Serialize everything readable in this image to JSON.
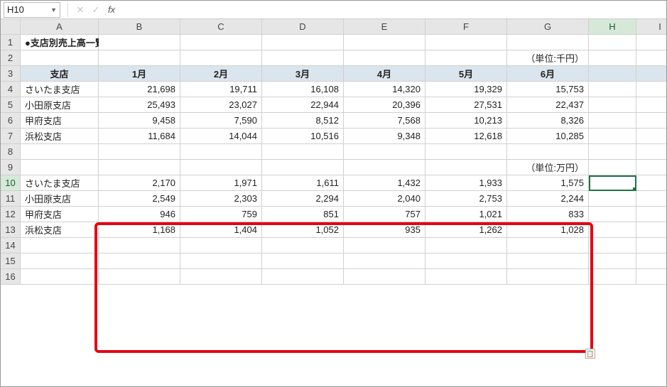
{
  "active_cell": "H10",
  "columns": [
    "A",
    "B",
    "C",
    "D",
    "E",
    "F",
    "G",
    "H",
    "I"
  ],
  "rows": [
    "1",
    "2",
    "3",
    "4",
    "5",
    "6",
    "7",
    "8",
    "9",
    "10",
    "11",
    "12",
    "13",
    "14",
    "15",
    "16"
  ],
  "title": "●支店別売上高一覧（上半期）",
  "unit_top": "（単位:千円）",
  "unit_bottom": "（単位:万円）",
  "header": {
    "store": "支店",
    "m1": "1月",
    "m2": "2月",
    "m3": "3月",
    "m4": "4月",
    "m5": "5月",
    "m6": "6月"
  },
  "data_top": [
    {
      "store": "さいたま支店",
      "v": [
        "21,698",
        "19,711",
        "16,108",
        "14,320",
        "19,329",
        "15,753"
      ]
    },
    {
      "store": "小田原支店",
      "v": [
        "25,493",
        "23,027",
        "22,944",
        "20,396",
        "27,531",
        "22,437"
      ]
    },
    {
      "store": "甲府支店",
      "v": [
        "9,458",
        "7,590",
        "8,512",
        "7,568",
        "10,213",
        "8,326"
      ]
    },
    {
      "store": "浜松支店",
      "v": [
        "11,684",
        "14,044",
        "10,516",
        "9,348",
        "12,618",
        "10,285"
      ]
    }
  ],
  "data_bottom": [
    {
      "store": "さいたま支店",
      "v": [
        "2,170",
        "1,971",
        "1,611",
        "1,432",
        "1,933",
        "1,575"
      ]
    },
    {
      "store": "小田原支店",
      "v": [
        "2,549",
        "2,303",
        "2,294",
        "2,040",
        "2,753",
        "2,244"
      ]
    },
    {
      "store": "甲府支店",
      "v": [
        "946",
        "759",
        "851",
        "757",
        "1,021",
        "833"
      ]
    },
    {
      "store": "浜松支店",
      "v": [
        "1,168",
        "1,404",
        "1,052",
        "935",
        "1,262",
        "1,028"
      ]
    }
  ],
  "chart_data": {
    "type": "table",
    "title": "支店別売上高一覧（上半期）",
    "series": [
      {
        "name": "千円",
        "categories": [
          "1月",
          "2月",
          "3月",
          "4月",
          "5月",
          "6月"
        ],
        "rows": {
          "さいたま支店": [
            21698,
            19711,
            16108,
            14320,
            19329,
            15753
          ],
          "小田原支店": [
            25493,
            23027,
            22944,
            20396,
            27531,
            22437
          ],
          "甲府支店": [
            9458,
            7590,
            8512,
            7568,
            10213,
            8326
          ],
          "浜松支店": [
            11684,
            14044,
            10516,
            9348,
            12618,
            10285
          ]
        }
      },
      {
        "name": "万円",
        "categories": [
          "1月",
          "2月",
          "3月",
          "4月",
          "5月",
          "6月"
        ],
        "rows": {
          "さいたま支店": [
            2170,
            1971,
            1611,
            1432,
            1933,
            1575
          ],
          "小田原支店": [
            2549,
            2303,
            2294,
            2040,
            2753,
            2244
          ],
          "甲府支店": [
            946,
            759,
            851,
            757,
            1021,
            833
          ],
          "浜松支店": [
            1168,
            1404,
            1052,
            935,
            1262,
            1028
          ]
        }
      }
    ]
  }
}
